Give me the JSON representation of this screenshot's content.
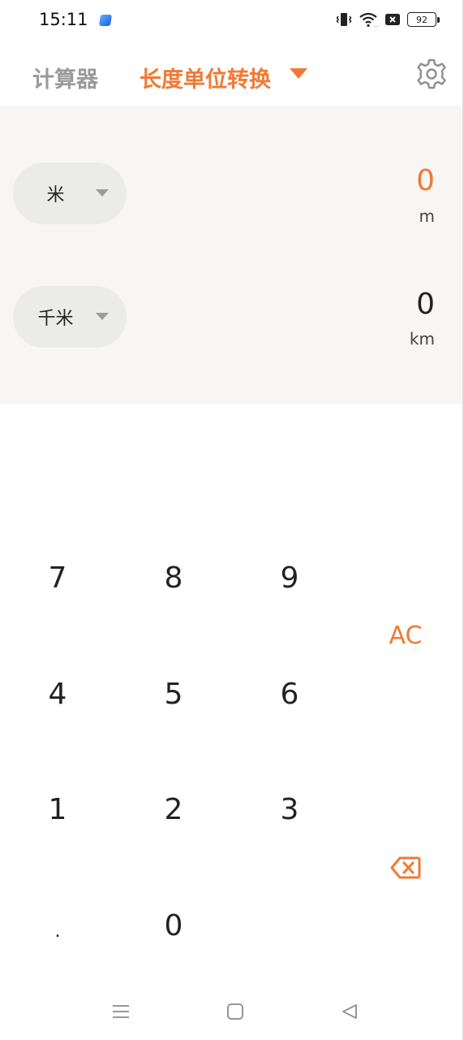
{
  "status_bar": {
    "time": "15:11",
    "icons": [
      "app-notification-icon",
      "vibrate-icon",
      "wifi-icon",
      "sim-blocked-icon",
      "battery-icon"
    ],
    "battery_level": "92"
  },
  "header": {
    "calculator_tab": "计算器",
    "converter_tab": "长度单位转换",
    "accent_color": "#f07a35",
    "settings_icon": "gear-icon"
  },
  "converter": {
    "from": {
      "unit_name": "米",
      "value": "0",
      "unit_symbol": "m"
    },
    "to": {
      "unit_name": "千米",
      "value": "0",
      "unit_symbol": "km"
    },
    "panel_color": "#f7f6f4"
  },
  "keypad": {
    "k7": "7",
    "k8": "8",
    "k9": "9",
    "k4": "4",
    "k5": "5",
    "k6": "6",
    "k1": "1",
    "k2": "2",
    "k3": "3",
    "kdot": ".",
    "k0": "0",
    "clear": "AC",
    "backspace_icon": "backspace-icon"
  },
  "nav_bar": {
    "icons": [
      "menu-icon",
      "home-icon",
      "back-icon"
    ]
  }
}
